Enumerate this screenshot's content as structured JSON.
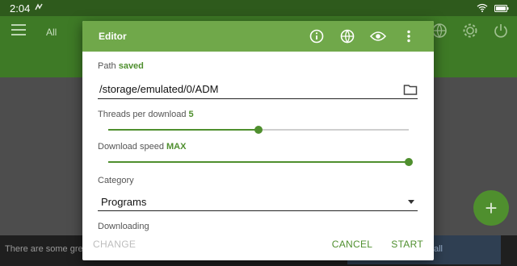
{
  "status_bar": {
    "time": "2:04"
  },
  "app": {
    "filter_label": "All"
  },
  "snackbar": {
    "text": "There are some grea",
    "action": "all"
  },
  "fab": {
    "label": "+"
  },
  "dialog": {
    "title": "Editor",
    "path": {
      "label": "Path",
      "status": "saved",
      "value": "/storage/emulated/0/ADM"
    },
    "threads": {
      "label": "Threads per download",
      "value": "5",
      "level_fraction": 0.5
    },
    "speed": {
      "label": "Download speed",
      "value": "MAX",
      "level_fraction": 1.0
    },
    "category": {
      "label": "Category",
      "value": "Programs"
    },
    "downloading": {
      "label": "Downloading"
    },
    "buttons": {
      "change": "CHANGE",
      "cancel": "CANCEL",
      "start": "START"
    }
  },
  "colors": {
    "accent": "#70a84a",
    "accent_dark": "#4f8f2e",
    "app_bar": "#3e7a26"
  }
}
